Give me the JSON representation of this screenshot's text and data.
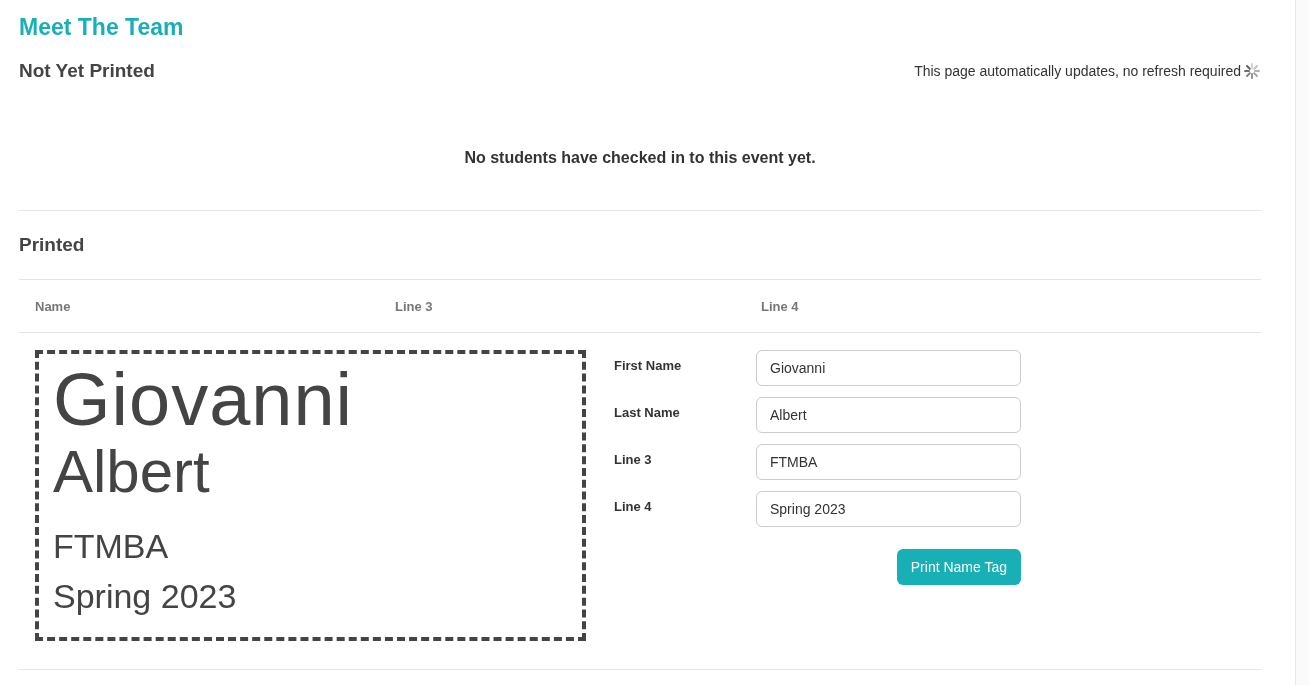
{
  "title": "Meet The Team",
  "not_yet_printed": {
    "heading": "Not Yet Printed",
    "notice": "This page automatically updates, no refresh required",
    "empty_message": "No students have checked in to this event yet."
  },
  "printed": {
    "heading": "Printed",
    "columns": [
      "Name",
      "Line 3",
      "Line 4"
    ],
    "rows": [
      {
        "name_tag": {
          "first_name": "Giovanni",
          "last_name": "Albert",
          "line_3": "FTMBA",
          "line_4": "Spring 2023"
        },
        "fields": [
          {
            "label": "First Name",
            "value": "Giovanni"
          },
          {
            "label": "Last Name",
            "value": "Albert"
          },
          {
            "label": "Line 3",
            "value": "FTMBA"
          },
          {
            "label": "Line 4",
            "value": "Spring 2023"
          }
        ],
        "button": "Print Name Tag"
      }
    ]
  }
}
